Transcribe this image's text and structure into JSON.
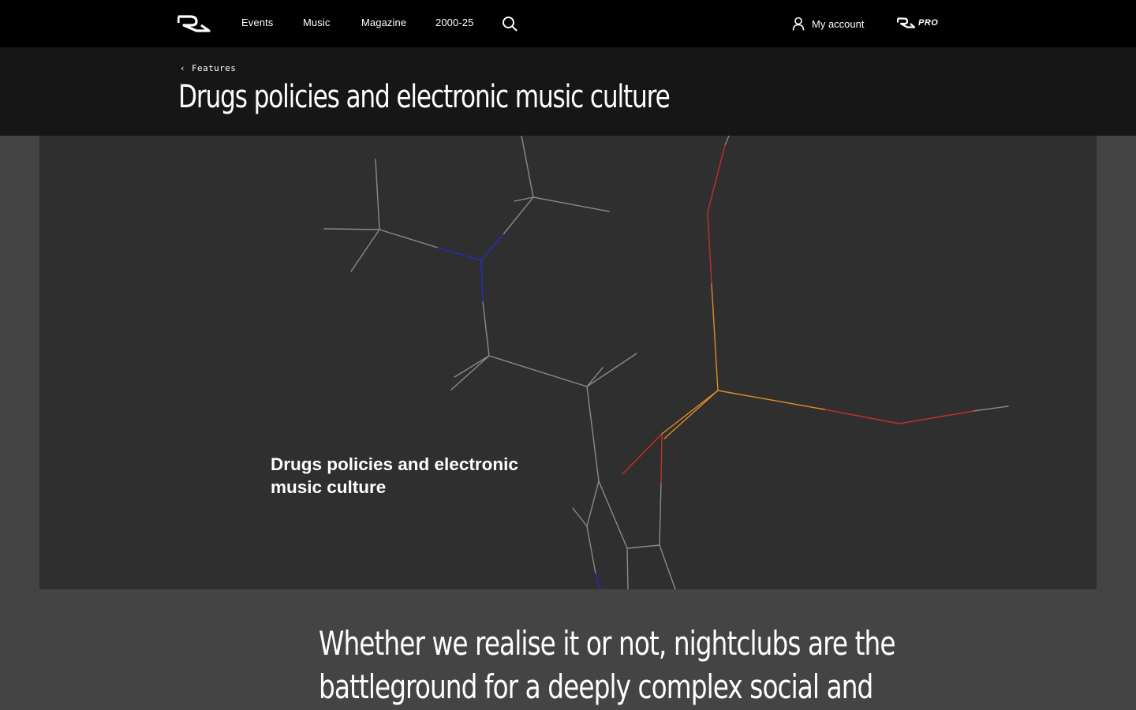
{
  "nav": {
    "logo_icon": "ra-logo-icon",
    "links": [
      "Events",
      "Music",
      "Magazine",
      "2000-25"
    ],
    "search_icon": "search-icon",
    "account_label": "My account",
    "account_icon": "user-icon",
    "pro_label": "PRO"
  },
  "subheader": {
    "breadcrumb": "Features",
    "title": "Drugs policies and electronic music culture"
  },
  "hero": {
    "caption": "Drugs policies and electronic music culture",
    "colors": {
      "background": "#2f2f2f",
      "bond_grey": "#8a8a8a",
      "bond_blue": "#2a2ac8",
      "bond_red": "#c0302a",
      "bond_orange": "#e08a2a"
    }
  },
  "article": {
    "intro": "Whether we realise it or not, nightclubs are the battleground for a deeply complex social and"
  },
  "colors": {
    "nav_bg": "#000000",
    "subheader_bg": "#161616",
    "page_bg": "#444444",
    "text": "#ffffff"
  }
}
